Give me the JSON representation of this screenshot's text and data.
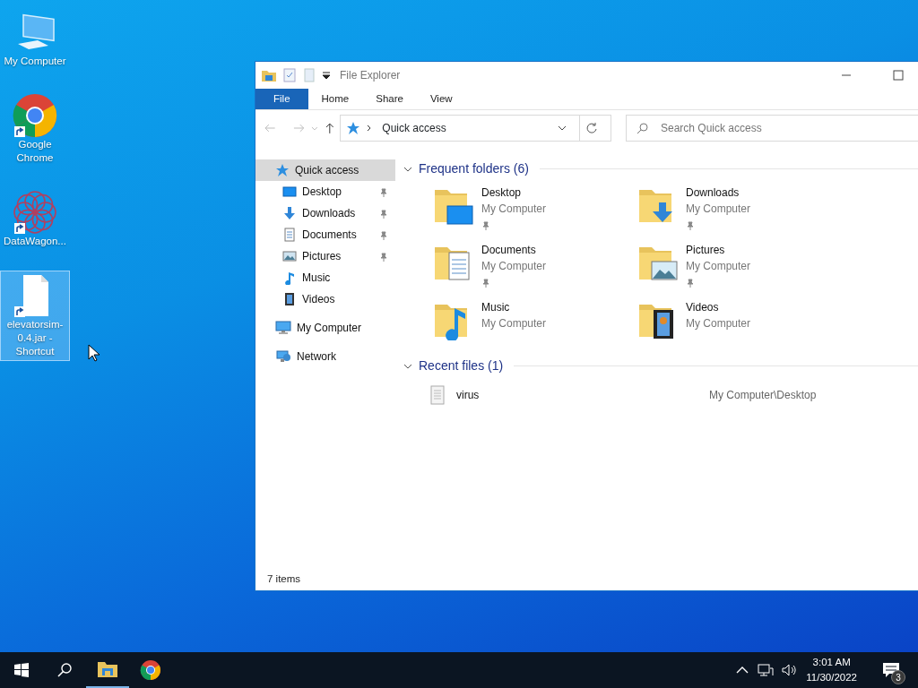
{
  "desktop_icons": [
    {
      "label": "My Computer",
      "kind": "computer",
      "shortcut": false,
      "selected": false
    },
    {
      "label": "Google Chrome",
      "kind": "chrome",
      "shortcut": true,
      "selected": false
    },
    {
      "label": "DataWagon...",
      "kind": "datawagon",
      "shortcut": true,
      "selected": false
    },
    {
      "label": "elevatorsim-0.4.jar - Shortcut",
      "kind": "file",
      "shortcut": true,
      "selected": true
    }
  ],
  "window": {
    "title": "File Explorer",
    "ribbon_tabs": [
      {
        "label": "File",
        "selected": true
      },
      {
        "label": "Home",
        "selected": false
      },
      {
        "label": "Share",
        "selected": false
      },
      {
        "label": "View",
        "selected": false
      }
    ],
    "address": "Quick access",
    "search": {
      "placeholder": "Search Quick access"
    },
    "nav_pane": [
      {
        "label": "Quick access",
        "kind": "star",
        "selected": true,
        "children": [
          {
            "label": "Desktop",
            "kind": "desktop",
            "pinned": true
          },
          {
            "label": "Downloads",
            "kind": "downloads",
            "pinned": true
          },
          {
            "label": "Documents",
            "kind": "documents",
            "pinned": true
          },
          {
            "label": "Pictures",
            "kind": "pictures",
            "pinned": true
          },
          {
            "label": "Music",
            "kind": "music",
            "pinned": false
          },
          {
            "label": "Videos",
            "kind": "videos",
            "pinned": false
          }
        ]
      },
      {
        "label": "My Computer",
        "kind": "computer",
        "selected": false
      },
      {
        "label": "Network",
        "kind": "network",
        "selected": false
      }
    ],
    "frequent_folders": {
      "title": "Frequent folders (6)",
      "expanded": true,
      "items": [
        {
          "name": "Desktop",
          "location": "My Computer",
          "kind": "desktop",
          "pinned": true
        },
        {
          "name": "Downloads",
          "location": "My Computer",
          "kind": "downloads",
          "pinned": true
        },
        {
          "name": "Documents",
          "location": "My Computer",
          "kind": "documents",
          "pinned": true
        },
        {
          "name": "Pictures",
          "location": "My Computer",
          "kind": "pictures",
          "pinned": true
        },
        {
          "name": "Music",
          "location": "My Computer",
          "kind": "music",
          "pinned": false
        },
        {
          "name": "Videos",
          "location": "My Computer",
          "kind": "videos",
          "pinned": false
        }
      ]
    },
    "recent_files": {
      "title": "Recent files (1)",
      "expanded": true,
      "items": [
        {
          "name": "virus",
          "path": "My Computer\\Desktop"
        }
      ]
    },
    "status_bar": "7 items"
  },
  "taskbar": {
    "apps": [
      {
        "kind": "explorer",
        "active": true
      },
      {
        "kind": "chrome",
        "active": false
      }
    ],
    "clock": {
      "time": "3:01 AM",
      "date": "11/30/2022"
    },
    "notification_count": "3"
  }
}
